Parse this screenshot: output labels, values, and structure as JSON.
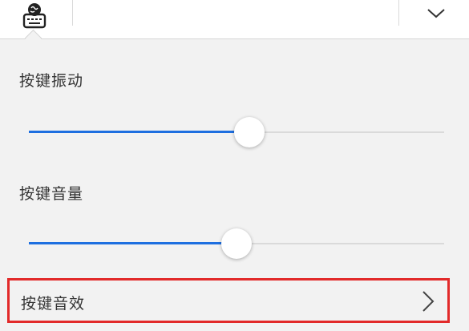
{
  "toolbar": {
    "keyboard_icon": "keyboard-globe-icon",
    "collapse_icon": "chevron-down-icon"
  },
  "settings": {
    "vibration": {
      "label": "按键振动",
      "value": 0.53
    },
    "volume": {
      "label": "按键音量",
      "value": 0.5
    },
    "sound_effect": {
      "label": "按键音效",
      "icon": "chevron-right-icon"
    }
  },
  "colors": {
    "accent": "#1e6fe0",
    "highlight_border": "#e22a2a",
    "background": "#f2f2f2"
  }
}
